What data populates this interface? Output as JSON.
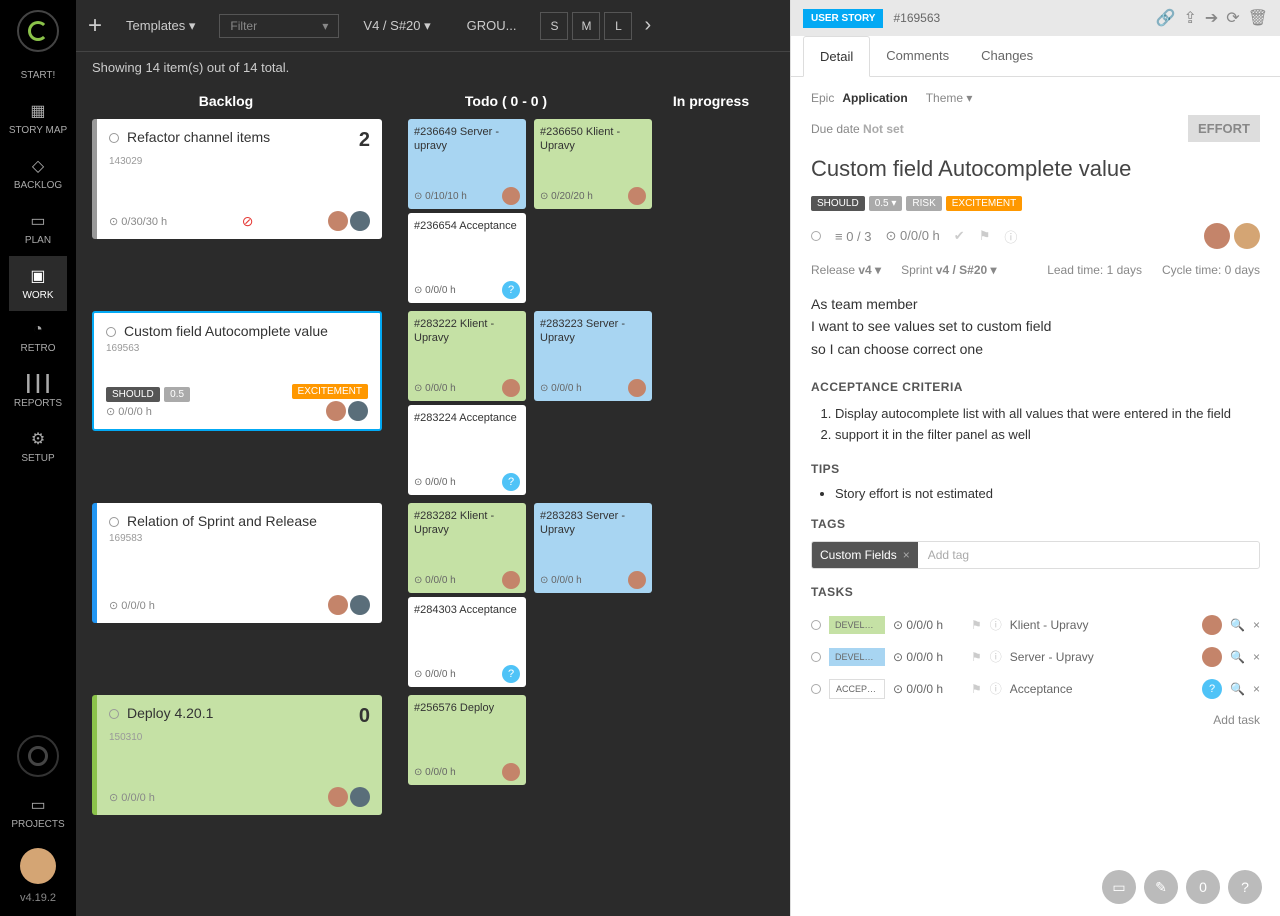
{
  "sidebar": {
    "start": "START!",
    "items": [
      {
        "icon": "▦",
        "label": "STORY MAP"
      },
      {
        "icon": "◇",
        "label": "BACKLOG"
      },
      {
        "icon": "▭",
        "label": "PLAN"
      },
      {
        "icon": "▣",
        "label": "WORK"
      },
      {
        "icon": "◔",
        "label": "RETRO"
      },
      {
        "icon": "┃┃┃",
        "label": "REPORTS"
      },
      {
        "icon": "⚙",
        "label": "SETUP"
      }
    ],
    "projects": "PROJECTS",
    "version": "v4.19.2"
  },
  "toolbar": {
    "templates": "Templates ▾",
    "filter_ph": "Filter",
    "v": "V4 / S#20 ▾",
    "group": "GROU...",
    "sizes": [
      "S",
      "M",
      "L"
    ]
  },
  "subbar": "Showing 14 item(s) out of 14 total.",
  "cols": {
    "backlog": "Backlog",
    "todo": "Todo   (   0   -   0   )",
    "prog": "In progress"
  },
  "stories": [
    {
      "id": "143029",
      "title": "Refactor channel items",
      "num": "2",
      "time": "0/30/30 h",
      "accent": "gray",
      "warn": true,
      "tasks": [
        {
          "t": "#236649 Server - upravy",
          "c": "blue",
          "time": "0/10/10 h",
          "av": true
        },
        {
          "t": "#236650 Klient - Upravy",
          "c": "green",
          "time": "0/20/20 h",
          "av": true
        },
        {
          "t": "#236654 Acceptance",
          "c": "white",
          "time": "0/0/0 h",
          "help": true
        }
      ]
    },
    {
      "id": "169563",
      "title": "Custom field Autocomplete value",
      "time": "0/0/0 h",
      "accent": "blue",
      "sel": true,
      "badges": [
        "SHOULD",
        "0.5",
        "EXCITEMENT"
      ],
      "tasks": [
        {
          "t": "#283222 Klient - Upravy",
          "c": "green",
          "time": "0/0/0 h",
          "av": true
        },
        {
          "t": "#283223 Server - Upravy",
          "c": "blue",
          "time": "0/0/0 h",
          "av": true
        },
        {
          "t": "#283224 Acceptance",
          "c": "white",
          "time": "0/0/0 h",
          "help": true
        }
      ]
    },
    {
      "id": "169583",
      "title": "Relation of Sprint and Release",
      "time": "0/0/0 h",
      "accent": "blue",
      "tasks": [
        {
          "t": "#283282 Klient - Upravy",
          "c": "green",
          "time": "0/0/0 h",
          "av": true
        },
        {
          "t": "#283283 Server - Upravy",
          "c": "blue",
          "time": "0/0/0 h",
          "av": true
        },
        {
          "t": "#284303 Acceptance",
          "c": "white",
          "time": "0/0/0 h",
          "help": true
        }
      ]
    },
    {
      "id": "150310",
      "title": "Deploy 4.20.1",
      "num": "0",
      "time": "0/0/0 h",
      "accent": "green",
      "card_green": true,
      "tasks": [
        {
          "t": "#256576 Deploy",
          "c": "green",
          "time": "0/0/0 h",
          "av": true
        }
      ]
    }
  ],
  "detail": {
    "pill": "USER STORY",
    "id": "#169563",
    "tabs": [
      "Detail",
      "Comments",
      "Changes"
    ],
    "epic_lbl": "Epic",
    "epic": "Application",
    "theme": "Theme ▾",
    "due_lbl": "Due date",
    "due": "Not set",
    "effort": "EFFORT",
    "title": "Custom field Autocomplete value",
    "badges": {
      "should": "SHOULD",
      "pts": "0.5",
      "risk": "RISK",
      "exc": "EXCITEMENT"
    },
    "stats": {
      "progress": "0 / 3",
      "time": "0/0/0 h"
    },
    "release_lbl": "Release",
    "release": "v4 ▾",
    "sprint_lbl": "Sprint",
    "sprint": "v4 / S#20 ▾",
    "lead_lbl": "Lead time:",
    "lead": "1 days",
    "cycle_lbl": "Cycle time:",
    "cycle": "0 days",
    "desc": [
      "As team member",
      "I want to see values set to custom field",
      "so I can choose correct one"
    ],
    "ac_h": "ACCEPTANCE CRITERIA",
    "ac": [
      "Display autocomplete list with all values that were entered in the field",
      "support it in the filter panel as well"
    ],
    "tips_h": "TIPS",
    "tips": [
      "Story effort is not estimated"
    ],
    "tags_h": "TAGS",
    "tag": "Custom Fields",
    "tag_ph": "Add tag",
    "tasks_h": "TASKS",
    "tasks": [
      {
        "b": "DEVELOPM...",
        "bc": "green",
        "time": "0/0/0 h",
        "name": "Klient - Upravy",
        "av": true
      },
      {
        "b": "DEVELOPM...",
        "bc": "blue",
        "time": "0/0/0 h",
        "name": "Server - Upravy",
        "av": true
      },
      {
        "b": "ACCEPTAN...",
        "bc": "white",
        "time": "0/0/0 h",
        "name": "Acceptance",
        "help": true
      }
    ],
    "add_task": "Add task"
  }
}
